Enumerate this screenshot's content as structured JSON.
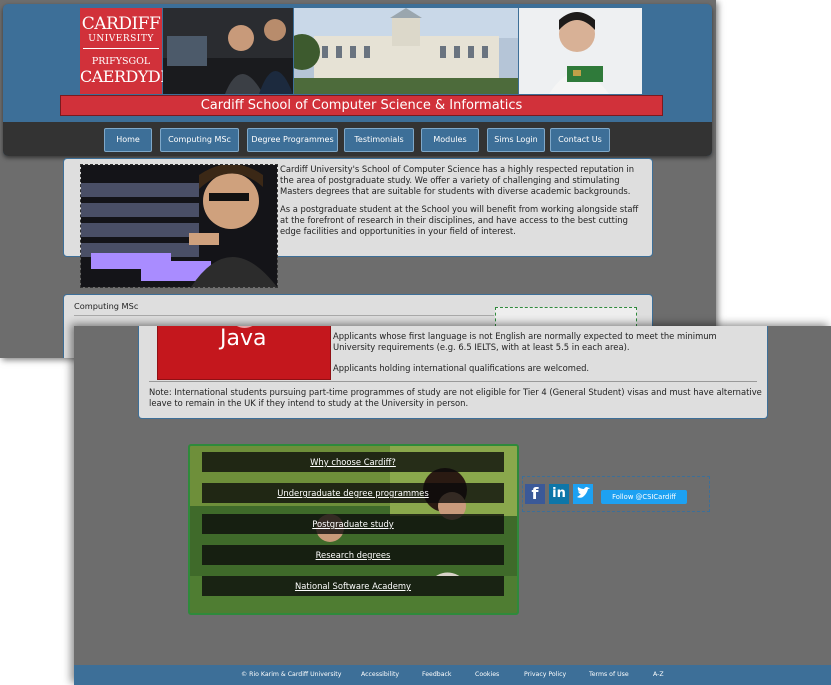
{
  "header": {
    "logo_line1": "CARDIFF",
    "logo_line2": "UNIVERSITY",
    "logo_line3": "PRIFYSGOL",
    "logo_line4": "CAERDYDD",
    "title": "Cardiff School of Computer Science & Informatics"
  },
  "nav": {
    "items": [
      {
        "label": "Home"
      },
      {
        "label": "Computing MSc"
      },
      {
        "label": "Degree Programmes"
      },
      {
        "label": "Testimonials"
      },
      {
        "label": "Modules"
      },
      {
        "label": "Sims Login"
      },
      {
        "label": "Contact Us"
      }
    ]
  },
  "intro": {
    "p1": "Cardiff University's School of Computer Science has a highly respected reputation in the area of postgraduate study. We offer a variety of challenging and stimulating Masters degrees that are suitable for students with diverse academic backgrounds.",
    "p2": "As a postgraduate student at the School you will benefit from working alongside staff at the forefront of research in their disciplines, and have access to the best cutting edge facilities and opportunities in your field of interest."
  },
  "section": {
    "title": "Computing MSc"
  },
  "entry": {
    "java_label": "Java",
    "p1": "Applicants whose first language is not English are normally expected to meet the minimum University requirements (e.g. 6.5 IELTS, with at least 5.5 in each area).",
    "p2": "Applicants holding international qualifications are welcomed.",
    "note": "Note: International students pursuing part-time programmes of study are not eligible for Tier 4 (General Student) visas and must have alternative leave to remain in the UK if they intend to study at the University in person."
  },
  "menu": {
    "items": [
      {
        "label": "Why choose Cardiff?"
      },
      {
        "label": "Undergraduate degree programmes"
      },
      {
        "label": "Postgraduate study"
      },
      {
        "label": "Research degrees"
      },
      {
        "label": "National Software Academy"
      }
    ]
  },
  "social": {
    "facebook": "f",
    "linkedin": "in",
    "twitter": "t",
    "follow": "Follow @CSICardiff"
  },
  "footer": {
    "items": [
      {
        "label": "© Rio Karim & Cardiff University"
      },
      {
        "label": "Accessibility"
      },
      {
        "label": "Feedback"
      },
      {
        "label": "Cookies"
      },
      {
        "label": "Privacy Policy"
      },
      {
        "label": "Terms of Use"
      },
      {
        "label": "A-Z"
      }
    ]
  },
  "colors": {
    "brand_red": "#d1313a",
    "nav_blue": "#3d6f98",
    "panel_bg": "#dedede",
    "accent_green": "#2f8a3b"
  }
}
